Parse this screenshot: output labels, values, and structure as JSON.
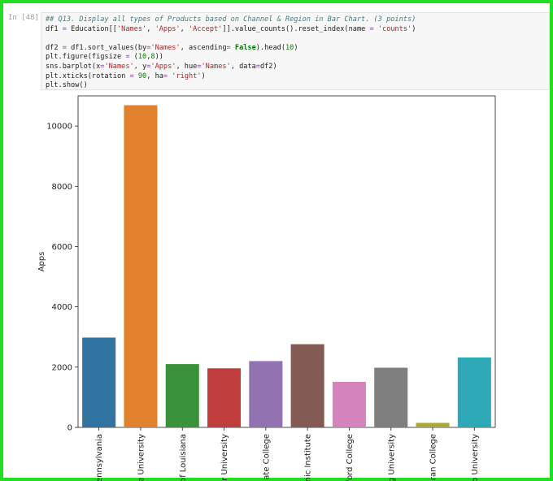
{
  "cell": {
    "prompt": "In [48]:",
    "code_lines": [
      [
        {
          "t": "## Q13. Display all types of Products based on Channel & Region in Bar Chart. (3 points)",
          "c": "comment"
        }
      ],
      [
        {
          "t": "df1 ",
          "c": ""
        },
        {
          "t": "=",
          "c": "op"
        },
        {
          "t": " Education[[",
          "c": ""
        },
        {
          "t": "'Names'",
          "c": "string"
        },
        {
          "t": ", ",
          "c": ""
        },
        {
          "t": "'Apps'",
          "c": "string"
        },
        {
          "t": ", ",
          "c": ""
        },
        {
          "t": "'Accept'",
          "c": "string"
        },
        {
          "t": "]].value_counts().reset_index(name ",
          "c": ""
        },
        {
          "t": "=",
          "c": "op"
        },
        {
          "t": " ",
          "c": ""
        },
        {
          "t": "'counts'",
          "c": "string"
        },
        {
          "t": ")",
          "c": ""
        }
      ],
      [
        {
          "t": "",
          "c": ""
        }
      ],
      [
        {
          "t": "df2 ",
          "c": ""
        },
        {
          "t": "=",
          "c": "op"
        },
        {
          "t": " df1.sort_values(by",
          "c": ""
        },
        {
          "t": "=",
          "c": "op"
        },
        {
          "t": "'Names'",
          "c": "string"
        },
        {
          "t": ", ascending",
          "c": ""
        },
        {
          "t": "=",
          "c": "op"
        },
        {
          "t": " ",
          "c": ""
        },
        {
          "t": "False",
          "c": "keyword"
        },
        {
          "t": ").head(",
          "c": ""
        },
        {
          "t": "10",
          "c": "number"
        },
        {
          "t": ")",
          "c": ""
        }
      ],
      [
        {
          "t": "plt.figure(figsize ",
          "c": ""
        },
        {
          "t": "=",
          "c": "op"
        },
        {
          "t": " (",
          "c": ""
        },
        {
          "t": "10",
          "c": "number"
        },
        {
          "t": ",",
          "c": ""
        },
        {
          "t": "8",
          "c": "number"
        },
        {
          "t": "))",
          "c": ""
        }
      ],
      [
        {
          "t": "sns.barplot(x",
          "c": ""
        },
        {
          "t": "=",
          "c": "op"
        },
        {
          "t": "'Names'",
          "c": "string"
        },
        {
          "t": ", y",
          "c": ""
        },
        {
          "t": "=",
          "c": "op"
        },
        {
          "t": "'Apps'",
          "c": "string"
        },
        {
          "t": ", hue",
          "c": ""
        },
        {
          "t": "=",
          "c": "op"
        },
        {
          "t": "'Names'",
          "c": "string"
        },
        {
          "t": ", data",
          "c": ""
        },
        {
          "t": "=",
          "c": "op"
        },
        {
          "t": "df2)",
          "c": ""
        }
      ],
      [
        {
          "t": "plt.xticks(rotation ",
          "c": ""
        },
        {
          "t": "=",
          "c": "op"
        },
        {
          "t": " ",
          "c": ""
        },
        {
          "t": "90",
          "c": "number"
        },
        {
          "t": ", ha",
          "c": ""
        },
        {
          "t": "=",
          "c": "op"
        },
        {
          "t": " ",
          "c": ""
        },
        {
          "t": "'right'",
          "c": "string"
        },
        {
          "t": ")",
          "c": ""
        }
      ],
      [
        {
          "t": "plt.show()",
          "c": ""
        }
      ]
    ]
  },
  "chart_data": {
    "type": "bar",
    "title": "",
    "xlabel": "",
    "ylabel": "Apps",
    "ylim": [
      0,
      11000
    ],
    "yticks": [
      0,
      2000,
      4000,
      6000,
      8000,
      10000
    ],
    "grid": false,
    "categories": [
      "ennsylvania",
      "e University",
      "of Louisiana",
      "r University",
      "ate College",
      "nic Institute",
      "ford College",
      "g University",
      "ran College",
      "p University"
    ],
    "values": [
      2980,
      10690,
      2100,
      1960,
      2200,
      2760,
      1510,
      1980,
      150,
      2320
    ],
    "colors": [
      "#3274a1",
      "#e1812c",
      "#3a923a",
      "#c03d3e",
      "#9372b2",
      "#845b53",
      "#d684bd",
      "#7f7f7f",
      "#a9aa35",
      "#2ea9b8"
    ]
  }
}
